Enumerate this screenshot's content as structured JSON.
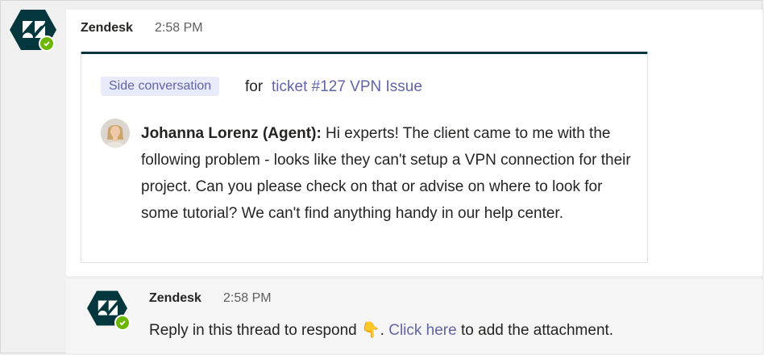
{
  "message1": {
    "sender": "Zendesk",
    "time": "2:58 PM",
    "avatar_icon": "zendesk-logo-icon",
    "status_icon": "available-check-icon",
    "card": {
      "chip_label": "Side conversation",
      "for_text": "for",
      "ticket_link": "ticket #127 VPN Issue",
      "agent_name": "Johanna Lorenz (Agent):",
      "agent_message": " Hi experts! The client came to me with the following problem - looks like they can't setup a VPN connection for their project. Can you please check on that or advise on where to look for some tutorial? We can't find anything handy in our help center."
    }
  },
  "message2": {
    "sender": "Zendesk",
    "time": "2:58 PM",
    "avatar_icon": "zendesk-logo-icon",
    "status_icon": "available-check-icon",
    "text_before": "Reply in this thread to respond ",
    "emoji": "👇",
    "text_mid": ". ",
    "link": "Click here",
    "text_after": " to add the attachment."
  },
  "colors": {
    "zendesk_dark": "#03363d",
    "link": "#6264a7",
    "chip_bg": "#e8ebfa",
    "status_green": "#6bb700"
  }
}
